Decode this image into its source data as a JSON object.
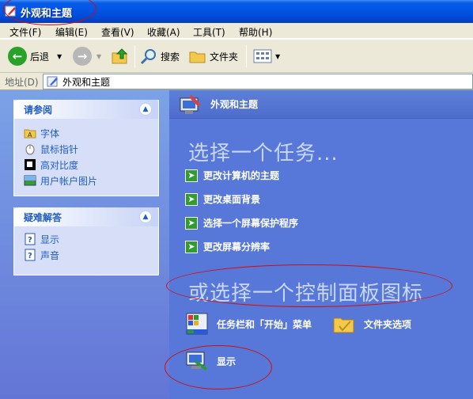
{
  "window": {
    "title": "外观和主题"
  },
  "menu": [
    "文件(F)",
    "编辑(E)",
    "查看(V)",
    "收藏(A)",
    "工具(T)",
    "帮助(H)"
  ],
  "toolbar": {
    "back": "后退",
    "search": "搜索",
    "folders": "文件夹"
  },
  "address": {
    "label": "地址(D)",
    "value": "外观和主题"
  },
  "see_also": {
    "title": "请参阅",
    "items": [
      "字体",
      "鼠标指针",
      "高对比度",
      "用户帐户图片"
    ]
  },
  "troubleshoot": {
    "title": "疑难解答",
    "items": [
      "显示",
      "声音"
    ]
  },
  "main": {
    "header": "外观和主题",
    "pick_task": "选择一个任务...",
    "tasks": [
      "更改计算机的主题",
      "更改桌面背景",
      "选择一个屏幕保护程序",
      "更改屏幕分辨率"
    ],
    "pick_icon": "或选择一个控制面板图标",
    "icons": [
      "任务栏和「开始」菜单",
      "文件夹选项",
      "显示"
    ]
  },
  "colors": {
    "accent": "#215dc6",
    "titlebar": "#0055e5",
    "annotation": "#d10d0d"
  }
}
